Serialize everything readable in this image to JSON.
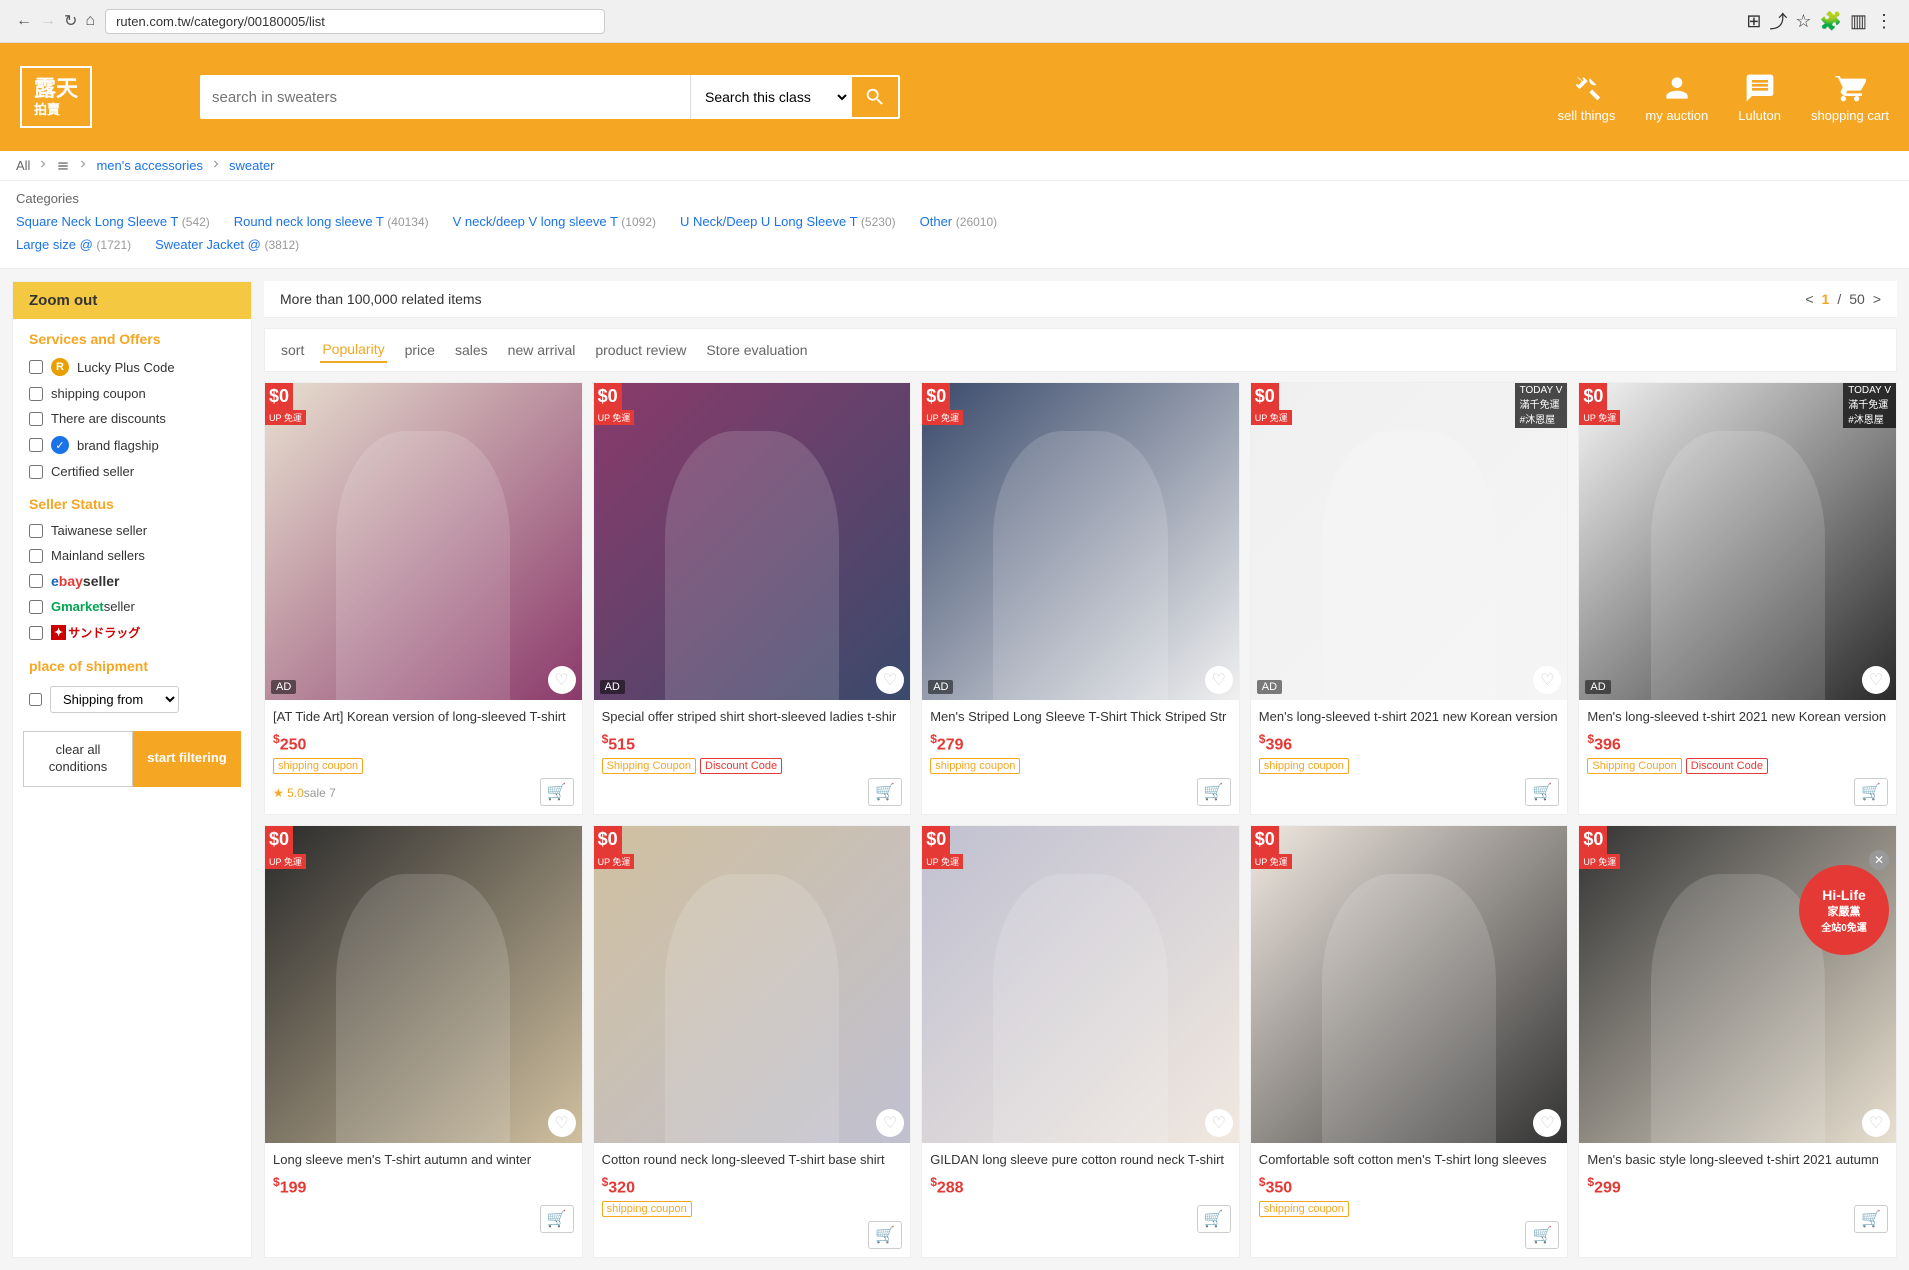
{
  "browser": {
    "url": "ruten.com.tw/category/00180005/list",
    "nav_back": "←",
    "nav_forward": "→",
    "nav_refresh": "↻",
    "nav_home": "⌂"
  },
  "header": {
    "logo_line1": "露天",
    "logo_line2": "拍賣",
    "search_placeholder": "search in sweaters",
    "search_dropdown_label": "Search this class",
    "search_btn_label": "🔍",
    "actions": [
      {
        "id": "sell-things",
        "label": "sell things",
        "icon": "hammer"
      },
      {
        "id": "my-auction",
        "label": "my auction",
        "icon": "person"
      },
      {
        "id": "luluton",
        "label": "Luluton",
        "icon": "chat"
      },
      {
        "id": "shopping-cart",
        "label": "shopping cart",
        "icon": "cart"
      }
    ]
  },
  "breadcrumb": {
    "all": "All",
    "items": [
      "men's accessories",
      "sweater"
    ]
  },
  "categories": {
    "title": "Categories",
    "items": [
      {
        "name": "Square Neck Long Sleeve T",
        "count": "542"
      },
      {
        "name": "Round neck long sleeve T",
        "count": "40134"
      },
      {
        "name": "V neck/deep V long sleeve T",
        "count": "1092"
      },
      {
        "name": "U Neck/Deep U Long Sleeve T",
        "count": "5230"
      },
      {
        "name": "Other",
        "count": "26010"
      },
      {
        "name": "Large size @",
        "count": "1721"
      },
      {
        "name": "Sweater Jacket @",
        "count": "3812"
      }
    ]
  },
  "sidebar": {
    "zoom_out_label": "Zoom out",
    "services_title": "Services and Offers",
    "services": [
      {
        "id": "lucky-plus",
        "label": "Lucky Plus Code",
        "badge": "R"
      },
      {
        "id": "shipping-coupon",
        "label": "shipping coupon"
      },
      {
        "id": "discounts",
        "label": "There are discounts"
      },
      {
        "id": "brand-flagship",
        "label": "brand flagship",
        "badge": "verified"
      },
      {
        "id": "certified-seller",
        "label": "Certified seller"
      }
    ],
    "seller_status_title": "Seller Status",
    "sellers": [
      {
        "id": "taiwanese",
        "label": "Taiwanese seller"
      },
      {
        "id": "mainland",
        "label": "Mainland sellers"
      },
      {
        "id": "ebay",
        "label": "eBay seller",
        "type": "ebay"
      },
      {
        "id": "gmarket",
        "label": "Gmarket seller",
        "type": "gmarket"
      },
      {
        "id": "sundrug",
        "label": "サンドラッグ",
        "type": "sundrug"
      }
    ],
    "place_title": "place of shipment",
    "from_shipping_label": "from Shipping",
    "shipping_option": "Shipping from",
    "clear_label": "clear all conditions",
    "filter_label": "start filtering"
  },
  "results": {
    "count_text": "More than 100,000 related items",
    "current_page": "1",
    "total_pages": "50",
    "prev": "<",
    "next": ">"
  },
  "sort": {
    "label": "sort",
    "tabs": [
      {
        "id": "popularity",
        "label": "Popularity",
        "active": true
      },
      {
        "id": "price",
        "label": "price",
        "active": false
      },
      {
        "id": "sales",
        "label": "sales",
        "active": false
      },
      {
        "id": "new-arrival",
        "label": "new arrival",
        "active": false
      },
      {
        "id": "product-review",
        "label": "product review",
        "active": false
      },
      {
        "id": "store-evaluation",
        "label": "Store evaluation",
        "active": false
      }
    ]
  },
  "products": [
    {
      "id": 1,
      "title": "[AT Tide Art] Korean version of long-sleeved T-shirt",
      "price": "250",
      "has_ship_coupon": true,
      "ship_coupon_label": "shipping coupon",
      "has_discount": false,
      "rating": "5.0",
      "sales": "sale 7",
      "ad": true,
      "free_ship": true,
      "image_class": "img-p1"
    },
    {
      "id": 2,
      "title": "Special offer striped shirt short-sleeved ladies t-shir",
      "price": "515",
      "has_ship_coupon": true,
      "ship_coupon_label": "Shipping Coupon",
      "has_discount": true,
      "discount_label": "Discount Code",
      "rating": "",
      "sales": "",
      "ad": true,
      "free_ship": true,
      "image_class": "img-p2"
    },
    {
      "id": 3,
      "title": "Men's Striped Long Sleeve T-Shirt Thick Striped Str",
      "price": "279",
      "has_ship_coupon": true,
      "ship_coupon_label": "shipping coupon",
      "has_discount": false,
      "rating": "",
      "sales": "",
      "ad": true,
      "free_ship": true,
      "image_class": "stripe-pattern-1"
    },
    {
      "id": 4,
      "title": "Men's long-sleeved t-shirt 2021 new Korean version",
      "price": "396",
      "has_ship_coupon": true,
      "ship_coupon_label": "shipping coupon",
      "has_discount": false,
      "rating": "",
      "sales": "",
      "ad": true,
      "free_ship": true,
      "today": true,
      "image_class": "img-p4"
    },
    {
      "id": 5,
      "title": "Men's long-sleeved t-shirt 2021 new Korean version",
      "price": "396",
      "has_ship_coupon": true,
      "ship_coupon_label": "Shipping Coupon",
      "has_discount": true,
      "discount_label": "Discount Code",
      "rating": "",
      "sales": "",
      "ad": true,
      "free_ship": true,
      "today": true,
      "image_class": "img-p5"
    },
    {
      "id": 6,
      "title": "Long sleeve men's T-shirt autumn and winter",
      "price": "199",
      "has_ship_coupon": false,
      "has_discount": false,
      "rating": "",
      "sales": "",
      "ad": false,
      "free_ship": true,
      "image_class": "img-p6"
    },
    {
      "id": 7,
      "title": "Cotton round neck long-sleeved T-shirt base shirt",
      "price": "320",
      "has_ship_coupon": true,
      "ship_coupon_label": "shipping coupon",
      "has_discount": false,
      "rating": "",
      "sales": "",
      "ad": false,
      "free_ship": true,
      "image_class": "img-p7"
    },
    {
      "id": 8,
      "title": "GILDAN long sleeve pure cotton round neck T-shirt",
      "price": "288",
      "has_ship_coupon": false,
      "has_discount": false,
      "rating": "",
      "sales": "",
      "ad": false,
      "free_ship": true,
      "image_class": "img-p8"
    },
    {
      "id": 9,
      "title": "Comfortable soft cotton men's T-shirt long sleeves",
      "price": "350",
      "has_ship_coupon": true,
      "ship_coupon_label": "shipping coupon",
      "has_discount": false,
      "rating": "",
      "sales": "",
      "ad": false,
      "free_ship": true,
      "image_class": "img-p9"
    },
    {
      "id": 10,
      "title": "Men's basic style long-sleeved t-shirt 2021 autumn",
      "price": "299",
      "has_ship_coupon": false,
      "has_discount": false,
      "rating": "",
      "sales": "",
      "ad": false,
      "free_ship": true,
      "image_class": "img-p10"
    }
  ],
  "hilife": {
    "line1": "Hi-Life",
    "line2": "家嚴黨",
    "line3": "全站0免運"
  }
}
